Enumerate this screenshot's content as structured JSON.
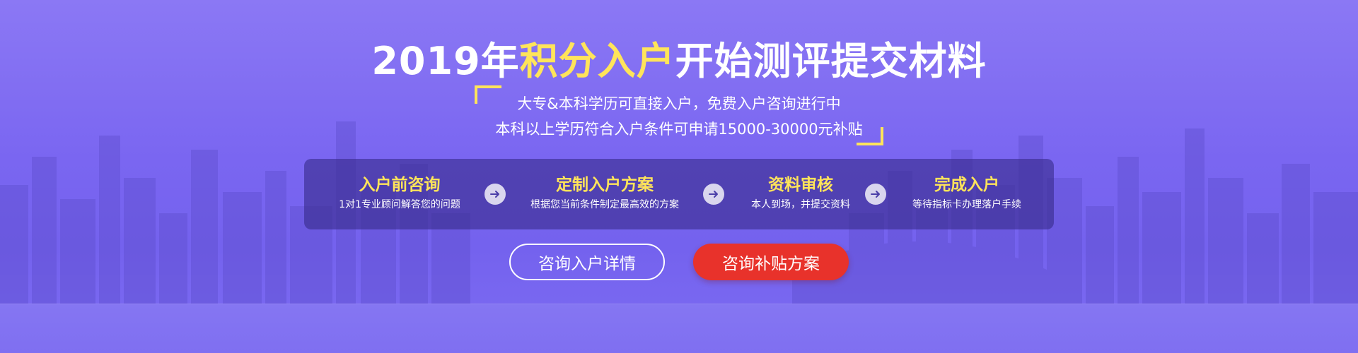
{
  "headline": {
    "prefix": "2019年",
    "highlight": "积分入户",
    "suffix": "开始测评提交材料"
  },
  "subtitle": {
    "line1": "大专&本科学历可直接入户，免费入户咨询进行中",
    "line2": "本科以上学历符合入户条件可申请15000-30000元补贴"
  },
  "steps": [
    {
      "title": "入户前咨询",
      "desc": "1对1专业顾问解答您的问题"
    },
    {
      "title": "定制入户方案",
      "desc": "根据您当前条件制定最高效的方案"
    },
    {
      "title": "资料审核",
      "desc": "本人到场，并提交资料"
    },
    {
      "title": "完成入户",
      "desc": "等待指标卡办理落户手续"
    }
  ],
  "buttons": {
    "consult_details": "咨询入户详情",
    "subsidy_plan": "咨询补贴方案"
  },
  "colors": {
    "accent_yellow": "#ffe45a",
    "button_red": "#e8322b",
    "background_purple": "#7a67f0"
  },
  "icons": {
    "step_separator": "arrow-right-icon"
  }
}
